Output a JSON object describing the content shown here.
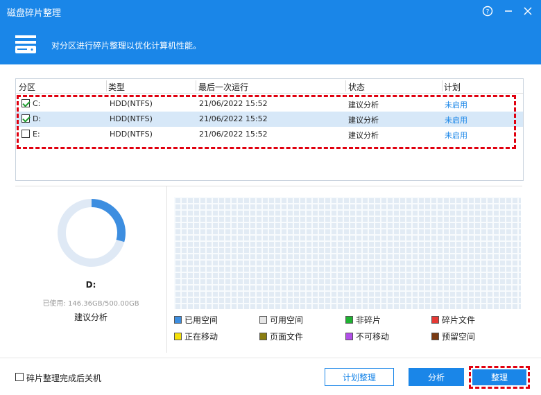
{
  "window": {
    "title": "磁盘碎片整理",
    "help_icon": "help-circle-icon",
    "close_icon": "close-icon"
  },
  "header": {
    "description": "对分区进行碎片整理以优化计算机性能。",
    "icon": "hard-drive-icon"
  },
  "table": {
    "columns": [
      "分区",
      "类型",
      "最后一次运行",
      "状态",
      "计划"
    ],
    "rows": [
      {
        "checked": true,
        "partition": "C:",
        "type": "HDD(NTFS)",
        "last_run": "21/06/2022 15:52",
        "status": "建议分析",
        "schedule": "未启用",
        "selected": false
      },
      {
        "checked": true,
        "partition": "D:",
        "type": "HDD(NTFS)",
        "last_run": "21/06/2022 15:52",
        "status": "建议分析",
        "schedule": "未启用",
        "selected": true
      },
      {
        "checked": false,
        "partition": "E:",
        "type": "HDD(NTFS)",
        "last_run": "21/06/2022 15:52",
        "status": "建议分析",
        "schedule": "未启用",
        "selected": false
      }
    ]
  },
  "drive_summary": {
    "drive": "D:",
    "used_text": "已使用: 146.36GB/500.00GB",
    "used_fraction": 0.293,
    "status": "建议分析"
  },
  "legend": [
    {
      "label": "已用空间",
      "color": "#3d8ee0"
    },
    {
      "label": "可用空间",
      "color": "#e6e6e6"
    },
    {
      "label": "非碎片",
      "color": "#1fb232"
    },
    {
      "label": "碎片文件",
      "color": "#e53935"
    },
    {
      "label": "正在移动",
      "color": "#f5e10a"
    },
    {
      "label": "页面文件",
      "color": "#8a7d10"
    },
    {
      "label": "不可移动",
      "color": "#b24fe8"
    },
    {
      "label": "预留空间",
      "color": "#7a3a12"
    }
  ],
  "footer": {
    "shutdown_label": "碎片整理完成后关机",
    "shutdown_checked": false,
    "schedule_button": "计划整理",
    "analyze_button": "分析",
    "defrag_button": "整理"
  },
  "colors": {
    "accent": "#1a86e8",
    "highlight": "#e0000f"
  }
}
